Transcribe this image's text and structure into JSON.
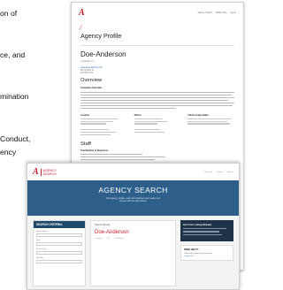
{
  "slide_text": {
    "lines": [
      "on of",
      "ce, and",
      "mination",
      "Conduct,",
      "ency"
    ]
  },
  "profile_page": {
    "logo": "A",
    "nav": [
      "Agency Search",
      "Profile View",
      "Log In"
    ],
    "page_title": "Agency Profile",
    "agency_name": "Doe-Anderson",
    "name_sub": "Louisville, KY",
    "website": "www.doeanderson.com",
    "address": "620 W Main St",
    "phone": "502.589.1700",
    "overview_heading": "Overview",
    "company_overview_label": "Company Overview",
    "col_headings": [
      "Location",
      "Offices",
      "Clients & Specialties"
    ],
    "staff_heading": "Staff",
    "staff_label": "Total Number of Employees"
  },
  "search_page": {
    "logo_mark": "A",
    "logo_text_1": "AGENCY",
    "logo_text_2": "SEARCH",
    "nav": [
      "Why Use",
      "Search",
      "Sign In"
    ],
    "hero_title": "AGENCY SEARCH",
    "hero_sub_1": "Find agency profiles, learn who matches your needs, and",
    "hero_sub_2": "connect with the right partner.",
    "filters_heading": "SEARCH CRITERIA",
    "filter_labels": [
      "Agency Name",
      "State",
      "Service Type",
      "Specialty"
    ],
    "results_heading": "Search Results",
    "result_name": "Doe-Anderson",
    "result_meta": [
      "Louisville",
      "KY",
      "Full Service"
    ],
    "promo_heading": "Get Your Listing Started",
    "help_heading": "NEED HELP?",
    "help_text": "Contact our agency search team",
    "help_link": "Contact Us"
  }
}
